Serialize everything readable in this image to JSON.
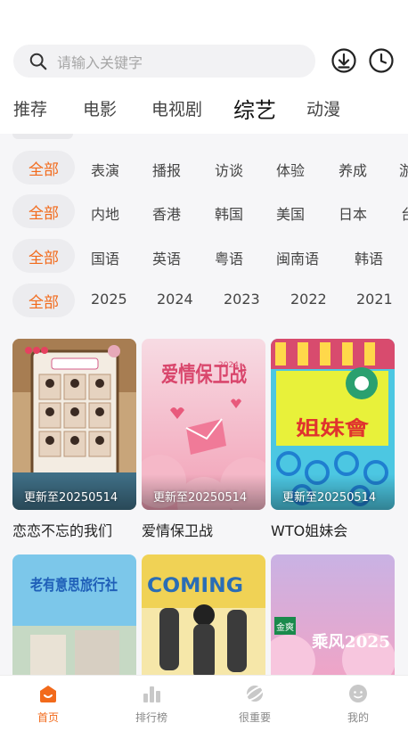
{
  "search": {
    "placeholder": "请输入关键字"
  },
  "top_icons": [
    "download-icon",
    "history-clock-icon"
  ],
  "tabs": [
    {
      "label": "推荐",
      "active": false
    },
    {
      "label": "电影",
      "active": false
    },
    {
      "label": "电视剧",
      "active": false
    },
    {
      "label": "综艺",
      "active": true
    },
    {
      "label": "动漫",
      "active": false
    }
  ],
  "filters": {
    "type": {
      "all": "全部",
      "options": [
        "表演",
        "播报",
        "访谈",
        "体验",
        "养成",
        "游"
      ]
    },
    "region": {
      "all": "全部",
      "options": [
        "内地",
        "香港",
        "韩国",
        "美国",
        "日本",
        "台"
      ]
    },
    "lang": {
      "all": "全部",
      "options": [
        "国语",
        "英语",
        "粤语",
        "闽南语",
        "韩语"
      ]
    },
    "year": {
      "all": "全部",
      "options": [
        "2025",
        "2024",
        "2023",
        "2022",
        "2021"
      ]
    }
  },
  "cards": [
    {
      "title": "恋恋不忘的我们",
      "update": "更新至20250514"
    },
    {
      "title": "爱情保卫战",
      "update": "更新至20250514",
      "poster_text": "爱情保卫战",
      "poster_badge": "2024"
    },
    {
      "title": "WTO姐妹会",
      "update": "更新至20250514",
      "poster_text": "姐妹會"
    }
  ],
  "more_cards": [
    {
      "poster_text": "老有意思旅行社"
    },
    {
      "poster_text": "COMING"
    },
    {
      "poster_text": "乘风2025",
      "badge": "金爽"
    }
  ],
  "bottom_nav": [
    {
      "label": "首页",
      "icon": "home-icon",
      "active": true
    },
    {
      "label": "排行榜",
      "icon": "ranking-icon",
      "active": false
    },
    {
      "label": "很重要",
      "icon": "planet-icon",
      "active": false
    },
    {
      "label": "我的",
      "icon": "profile-icon",
      "active": false
    }
  ],
  "colors": {
    "accent": "#f26a1b",
    "pill_bg": "#ececef",
    "page_bg": "#f6f6f8"
  }
}
